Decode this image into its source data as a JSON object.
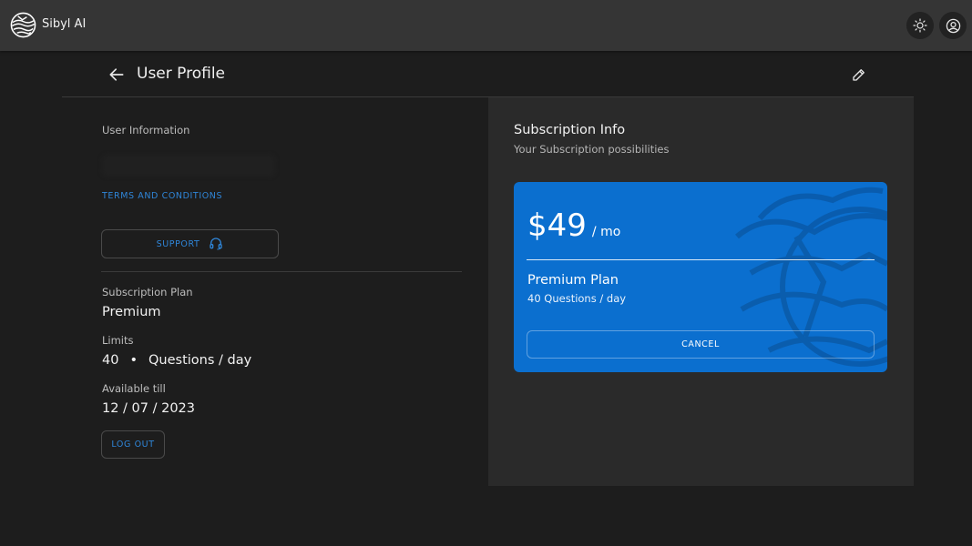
{
  "app": {
    "name": "Sibyl AI"
  },
  "topbar": {
    "theme_icon": "sun-icon",
    "account_icon": "account-circle-icon"
  },
  "header": {
    "title": "User Profile",
    "back_icon": "arrow-left-icon",
    "edit_icon": "pencil-icon"
  },
  "user": {
    "info_label": "User Information",
    "terms_label": "TERMS AND CONDITIONS",
    "support_label": "SUPPORT",
    "support_icon": "headset-icon",
    "plan_label": "Subscription Plan",
    "plan_value": "Premium",
    "limits_label": "Limits",
    "limits_count": "40",
    "limits_bullet": "•",
    "limits_unit": "Questions / day",
    "available_label": "Available till",
    "available_value": "12 / 07 / 2023",
    "logout_label": "LOG OUT"
  },
  "subscription": {
    "title": "Subscription Info",
    "subtitle": "Your Subscription possibilities",
    "card": {
      "price": "$49",
      "period": "/ mo",
      "plan_name": "Premium Plan",
      "plan_limit": "40 Questions / day",
      "cancel_label": "CANCEL"
    }
  },
  "colors": {
    "accent": "#2f86d9",
    "card": "#0b6fcf",
    "appbar": "#353535",
    "background": "#1d1d1d",
    "panel": "#2a2a2a"
  }
}
